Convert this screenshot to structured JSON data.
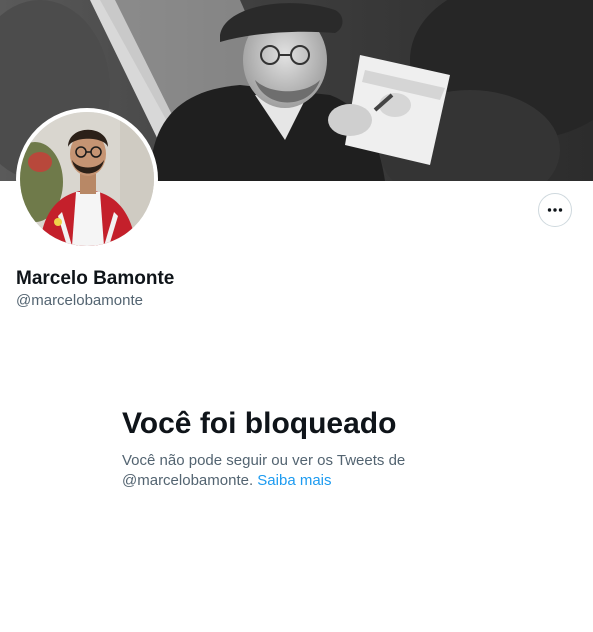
{
  "profile": {
    "display_name": "Marcelo Bamonte",
    "handle": "@marcelobamonte"
  },
  "icons": {
    "banner": "header-photo",
    "avatar": "profile-photo",
    "more": "more-options-icon"
  },
  "blocked": {
    "title": "Você foi bloqueado",
    "message": "Você não pode seguir ou ver os Tweets de @marcelobamonte.",
    "link_label": "Saiba mais"
  },
  "colors": {
    "link": "#1d9bf0",
    "secondary_text": "#536471",
    "primary_text": "#0f1419",
    "border": "#cfd9de"
  }
}
